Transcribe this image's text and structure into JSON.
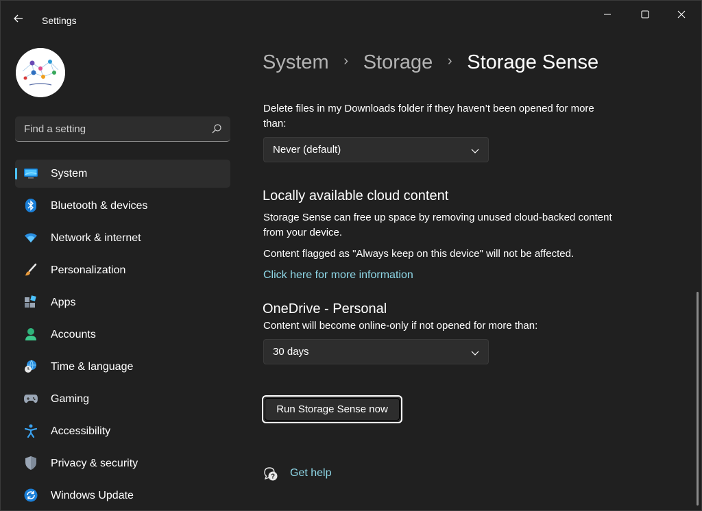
{
  "window": {
    "title": "Settings"
  },
  "search": {
    "placeholder": "Find a setting"
  },
  "sidebar": {
    "items": [
      {
        "label": "System",
        "icon": "system-display-icon",
        "active": true
      },
      {
        "label": "Bluetooth & devices",
        "icon": "bluetooth-icon"
      },
      {
        "label": "Network & internet",
        "icon": "wifi-icon"
      },
      {
        "label": "Personalization",
        "icon": "brush-icon"
      },
      {
        "label": "Apps",
        "icon": "apps-icon"
      },
      {
        "label": "Accounts",
        "icon": "person-icon"
      },
      {
        "label": "Time & language",
        "icon": "globe-clock-icon"
      },
      {
        "label": "Gaming",
        "icon": "gamepad-icon"
      },
      {
        "label": "Accessibility",
        "icon": "accessibility-icon"
      },
      {
        "label": "Privacy & security",
        "icon": "shield-icon"
      },
      {
        "label": "Windows Update",
        "icon": "update-icon"
      }
    ]
  },
  "breadcrumb": {
    "level1": "System",
    "level2": "Storage",
    "current": "Storage Sense",
    "separator": "›"
  },
  "downloads": {
    "description": "Delete files in my Downloads folder if they haven’t been opened for more than:",
    "selected": "Never (default)"
  },
  "cloud": {
    "heading": "Locally available cloud content",
    "description": "Storage Sense can free up space by removing unused cloud-backed content from your device.",
    "note": "Content flagged as \"Always keep on this device\" will not be affected.",
    "link": "Click here for more information"
  },
  "onedrive": {
    "heading": "OneDrive - Personal",
    "description": "Content will become online-only if not opened for more than:",
    "selected": "30 days"
  },
  "actions": {
    "run_label": "Run Storage Sense now"
  },
  "help": {
    "label": "Get help"
  },
  "colors": {
    "accent": "#4cc2ff",
    "link": "#8fd8e8",
    "background": "#202020",
    "control": "#2d2d2d"
  }
}
